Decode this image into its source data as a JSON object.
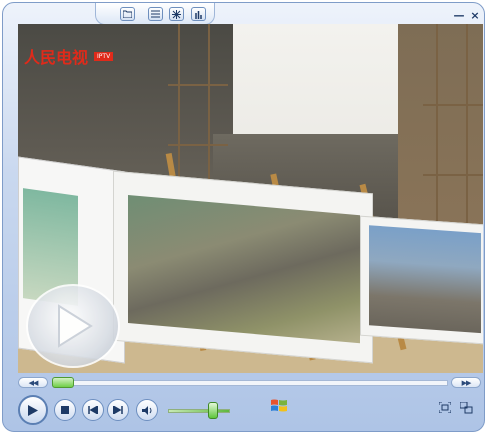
{
  "window": {
    "top_buttons": [
      {
        "icon": "folder-icon"
      },
      {
        "icon": "list-icon"
      },
      {
        "icon": "visualization-icon"
      },
      {
        "icon": "equalizer-icon"
      }
    ],
    "minimize_label": "—",
    "close_label": "×"
  },
  "video": {
    "logo_text": "人民电视",
    "logo_accent": "#e02a1a",
    "badge_text": "IPTV"
  },
  "seek": {
    "back_label": "◀◀",
    "forward_label": "▶▶",
    "position": 0.0
  },
  "controls": {
    "volume_level": 0.72,
    "accent_color": "#5eb83e"
  },
  "colors": {
    "frame": "#c9d8ef",
    "border": "#7f9cc8"
  }
}
